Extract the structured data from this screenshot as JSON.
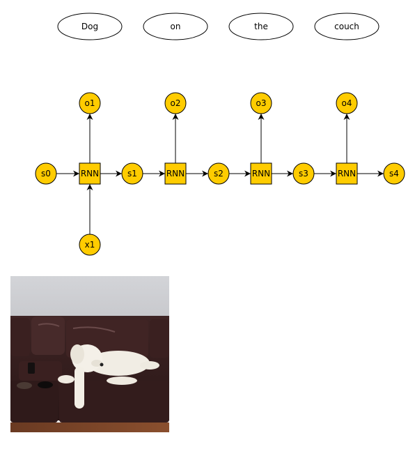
{
  "words": [
    "Dog",
    "on",
    "the",
    "couch"
  ],
  "outputs": [
    "o1",
    "o2",
    "o3",
    "o4"
  ],
  "states": [
    "s0",
    "s1",
    "s2",
    "s3",
    "s4"
  ],
  "cells": [
    "RNN",
    "RNN",
    "RNN",
    "RNN"
  ],
  "inputs": [
    "x1"
  ],
  "colors": {
    "node_fill": "#FFCC00",
    "stroke": "#000000",
    "oval_fill": "#FFFFFF"
  },
  "image": {
    "description": "Photo of a white poodle lying on a dark brown leather couch"
  }
}
